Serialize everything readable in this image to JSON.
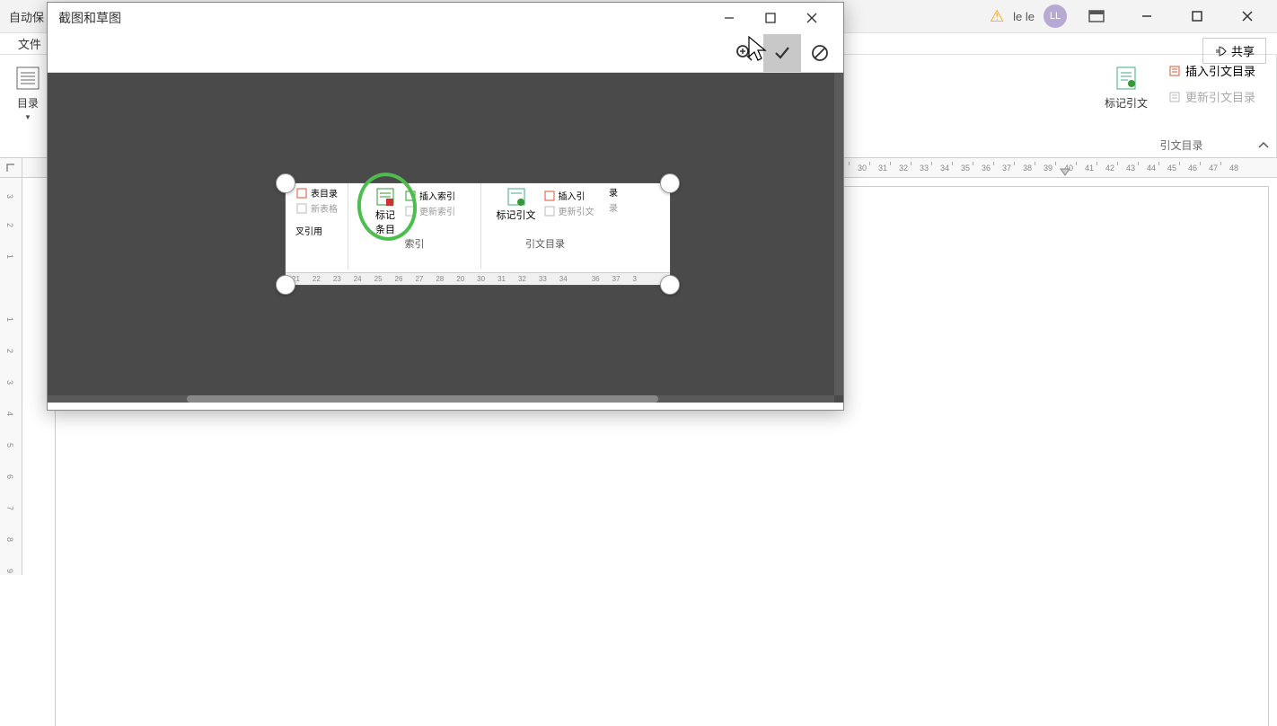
{
  "titlebar": {
    "autosave": "自动保",
    "user_label": "le le",
    "avatar_text": "LL"
  },
  "ribbon": {
    "file_tab": "文件",
    "toc_label": "目录",
    "mark_citation": "标记引文",
    "insert_citation_toc": "插入引文目录",
    "update_citation_toc": "更新引文目录",
    "citation_group_title": "引文目录",
    "share_label": "共享"
  },
  "dialog": {
    "title": "截图和草图"
  },
  "ruler_h": [
    "30",
    "31",
    "32",
    "33",
    "34",
    "35",
    "36",
    "37",
    "38",
    "39",
    "40",
    "41",
    "42",
    "43",
    "44",
    "45",
    "46",
    "47",
    "48"
  ],
  "ruler_v_top": [
    "3",
    "2",
    "1"
  ],
  "ruler_v_bottom": [
    "1",
    "2",
    "3",
    "4",
    "5",
    "6",
    "7",
    "8",
    "9"
  ],
  "capture": {
    "insert_table_toc": "表目录",
    "update_table": "新表格",
    "cross_ref": "叉引用",
    "mark_entry_l1": "标记",
    "mark_entry_l2": "条目",
    "insert_index": "插入索引",
    "update_index": "更新索引",
    "index_label": "索引",
    "mark_citation_big": "标记引文",
    "insert_cite": "插入引",
    "update_cite": "更新引文",
    "cite_label_partial": "录",
    "citation_group": "引文目录",
    "ruler": [
      "21",
      "22",
      "23",
      "24",
      "25",
      "26",
      "27",
      "28",
      "20",
      "30",
      "31",
      "32",
      "33",
      "34",
      "36",
      "37",
      "3"
    ]
  }
}
